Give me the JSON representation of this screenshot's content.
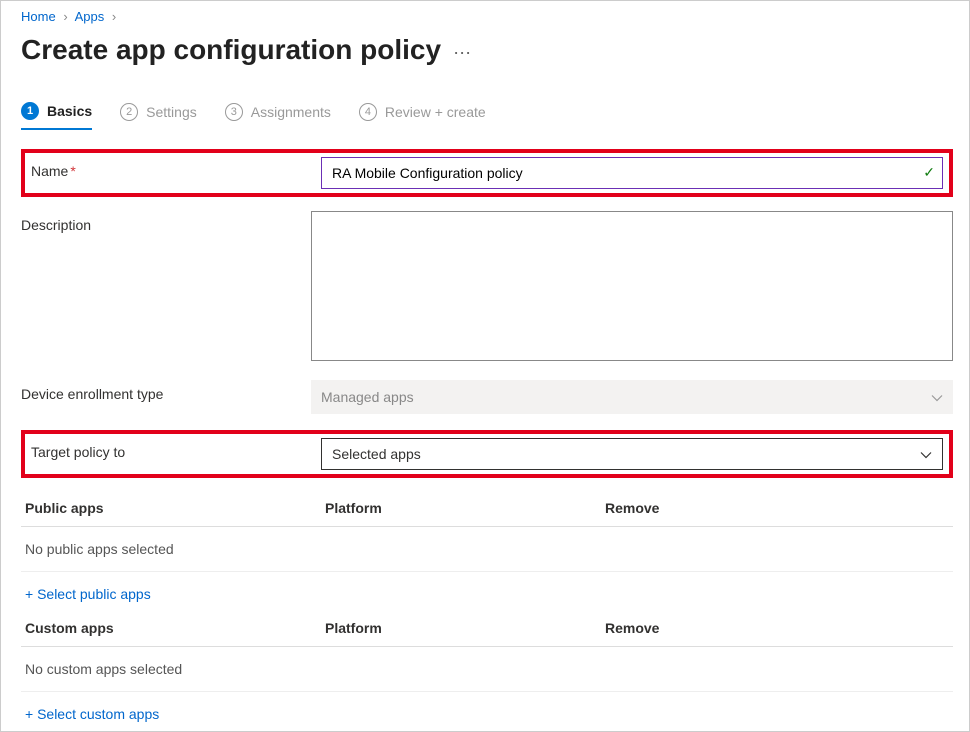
{
  "breadcrumb": {
    "home": "Home",
    "apps": "Apps"
  },
  "page_title": "Create app configuration policy",
  "tabs": [
    {
      "num": "1",
      "label": "Basics"
    },
    {
      "num": "2",
      "label": "Settings"
    },
    {
      "num": "3",
      "label": "Assignments"
    },
    {
      "num": "4",
      "label": "Review + create"
    }
  ],
  "fields": {
    "name_label": "Name",
    "name_value": "RA Mobile Configuration policy",
    "description_label": "Description",
    "description_value": "",
    "enrollment_label": "Device enrollment type",
    "enrollment_value": "Managed apps",
    "target_label": "Target policy to",
    "target_value": "Selected apps"
  },
  "public_apps": {
    "header_name": "Public apps",
    "header_platform": "Platform",
    "header_remove": "Remove",
    "empty": "No public apps selected",
    "add": "+ Select public apps"
  },
  "custom_apps": {
    "header_name": "Custom apps",
    "header_platform": "Platform",
    "header_remove": "Remove",
    "empty": "No custom apps selected",
    "add": "+ Select custom apps"
  }
}
